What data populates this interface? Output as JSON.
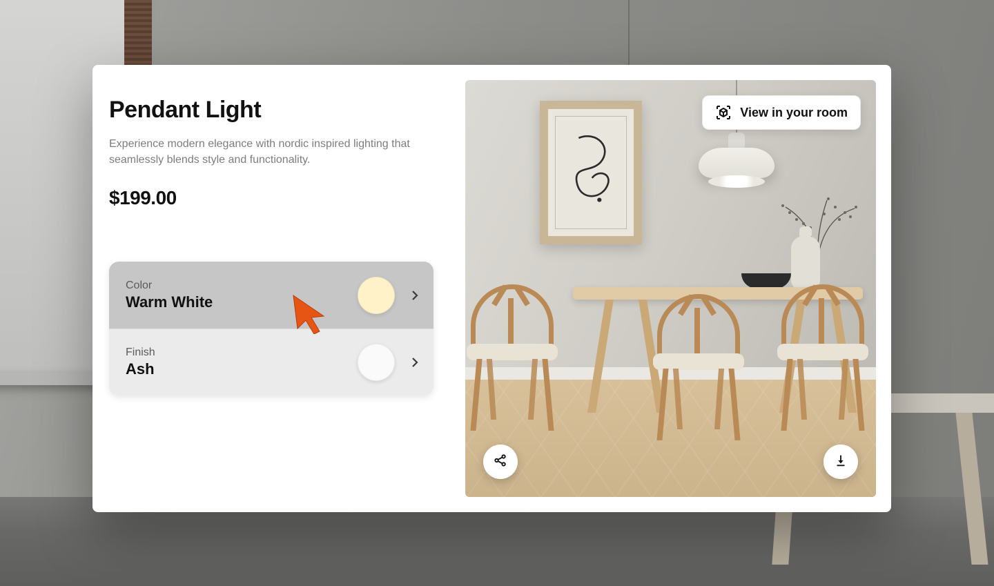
{
  "product": {
    "title": "Pendant Light",
    "description": "Experience modern elegance with nordic inspired lighting that seamlessly blends style and functionality.",
    "price": "$199.00"
  },
  "options": {
    "color": {
      "label": "Color",
      "value": "Warm White",
      "swatch_hex": "#fff1c8"
    },
    "finish": {
      "label": "Finish",
      "value": "Ash",
      "swatch_hex": "#fafafa"
    }
  },
  "image_actions": {
    "view_in_room_label": "View in your room",
    "share_label": "Share",
    "download_label": "Download"
  }
}
